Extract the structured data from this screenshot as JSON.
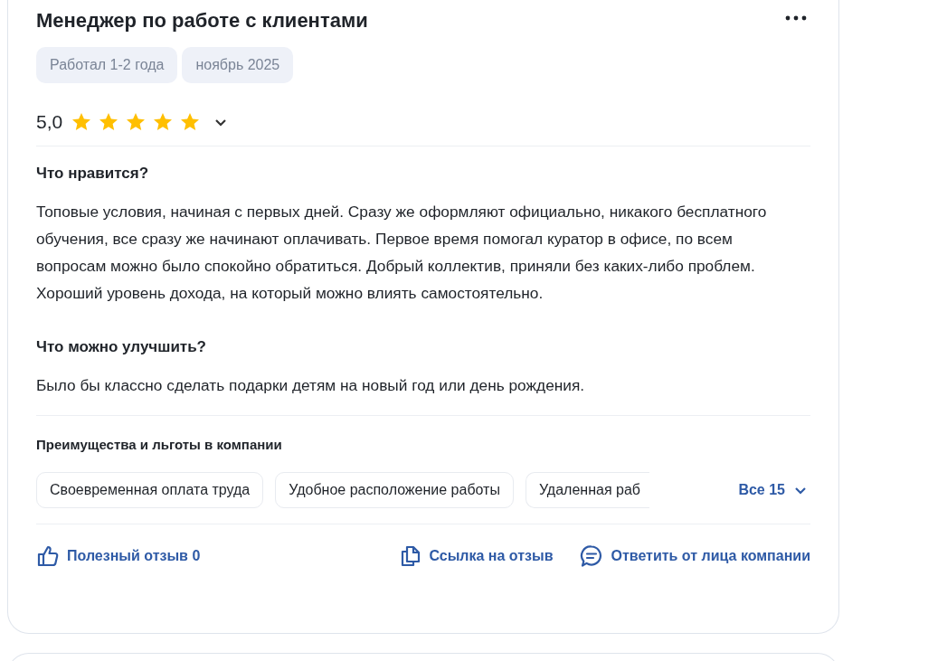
{
  "review": {
    "title": "Менеджер по работе с клиентами",
    "tags": [
      "Работал 1-2 года",
      "ноябрь 2025"
    ],
    "rating": {
      "value": "5,0",
      "stars": 5
    },
    "sections": [
      {
        "heading": "Что нравится?",
        "text": "Топовые условия, начиная с первых дней. Сразу же оформляют официально, никакого бесплатного обучения, все сразу же начинают оплачивать. Первое время помогал куратор в офисе, по всем вопросам можно было спокойно обратиться. Добрый коллектив, приняли без каких-либо проблем. Хороший уровень дохода, на который можно влиять самостоятельно."
      },
      {
        "heading": "Что можно улучшить?",
        "text": "Было бы классно сделать подарки детям на новый год или день рождения."
      }
    ],
    "benefits": {
      "heading": "Преимущества и льготы в компании",
      "items": [
        "Своевременная оплата труда",
        "Удобное расположение работы",
        "Удаленная раб"
      ],
      "more": "Все 15"
    },
    "actions": [
      {
        "kind": "like",
        "label": "Полезный отзыв 0"
      },
      {
        "kind": "link",
        "label": "Ссылка на отзыв"
      },
      {
        "kind": "reply",
        "label": "Ответить от лица компании"
      }
    ]
  }
}
